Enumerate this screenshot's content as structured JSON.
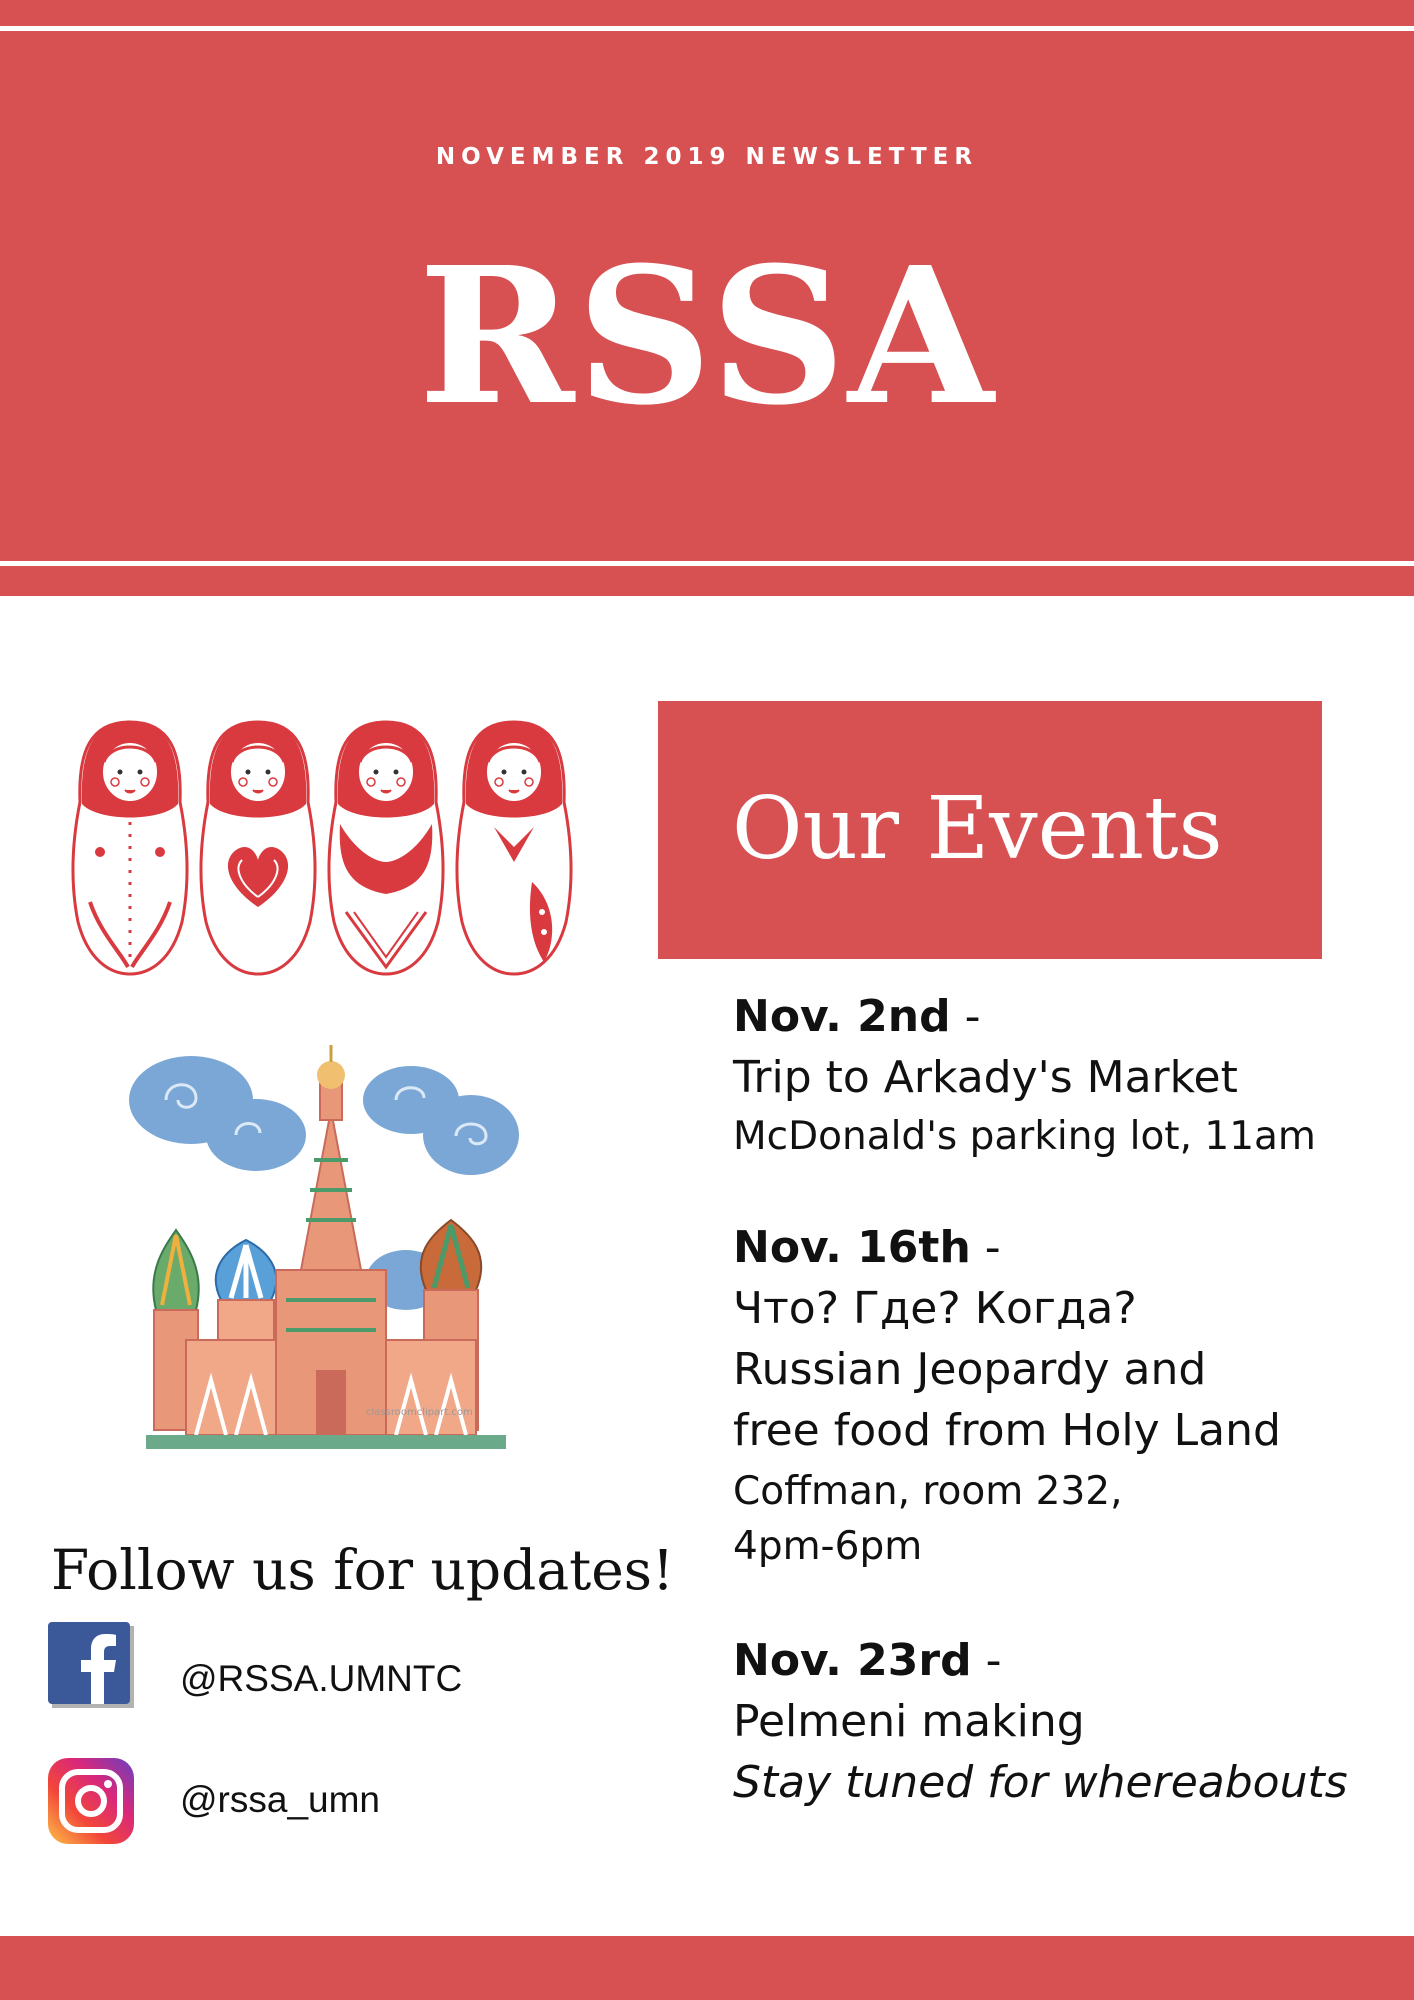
{
  "header": {
    "subtitle": "NOVEMBER 2019 NEWSLETTER",
    "title": "RSSA"
  },
  "events": {
    "heading": "Our Events",
    "items": [
      {
        "date": "Nov. 2nd",
        "sep": " -",
        "lines": [
          "Trip to Arkady's Market"
        ],
        "detail": [
          " McDonald's parking lot, 11am"
        ]
      },
      {
        "date": "Nov. 16th",
        "sep": " -",
        "lines": [
          "Что? Где? Когда?",
          "Russian Jeopardy and",
          "free food from Holy Land"
        ],
        "detail": [
          "Coffman, room 232,",
          "4pm-6pm"
        ]
      },
      {
        "date": "Nov. 23rd",
        "sep": " -",
        "lines": [
          "Pelmeni making"
        ],
        "detail": [
          "Stay tuned for whereabouts"
        ]
      }
    ]
  },
  "follow": {
    "heading": "Follow us for updates!",
    "facebook": "@RSSA.UMNTC",
    "instagram": "@rssa_umn"
  },
  "illustrations": {
    "dolls": "matryoshka-dolls-illustration",
    "cathedral": "st-basils-cathedral-illustration",
    "watermark": "classroomclipart.com"
  },
  "colors": {
    "accent": "#d75153",
    "doll_red": "#d83a3f",
    "sky_blue": "#7ba7d6"
  }
}
